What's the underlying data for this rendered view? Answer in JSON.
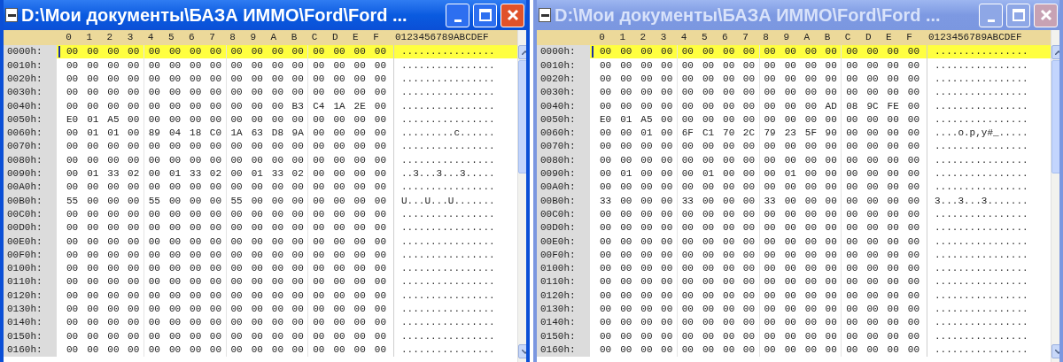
{
  "windows": [
    {
      "title": "D:\\Мои документы\\БАЗА ИММО\\Ford\\Ford ...",
      "active": true,
      "header": {
        "columns": [
          "0",
          "1",
          "2",
          "3",
          "4",
          "5",
          "6",
          "7",
          "8",
          "9",
          "A",
          "B",
          "C",
          "D",
          "E",
          "F"
        ],
        "ascii": "0123456789ABCDEF"
      },
      "rows": [
        {
          "offset": "0000h:",
          "bytes": [
            "00",
            "00",
            "00",
            "00",
            "00",
            "00",
            "00",
            "00",
            "00",
            "00",
            "00",
            "00",
            "00",
            "00",
            "00",
            "00"
          ],
          "ascii": "................",
          "selected": true
        },
        {
          "offset": "0010h:",
          "bytes": [
            "00",
            "00",
            "00",
            "00",
            "00",
            "00",
            "00",
            "00",
            "00",
            "00",
            "00",
            "00",
            "00",
            "00",
            "00",
            "00"
          ],
          "ascii": "................",
          "selected": false
        },
        {
          "offset": "0020h:",
          "bytes": [
            "00",
            "00",
            "00",
            "00",
            "00",
            "00",
            "00",
            "00",
            "00",
            "00",
            "00",
            "00",
            "00",
            "00",
            "00",
            "00"
          ],
          "ascii": "................",
          "selected": false
        },
        {
          "offset": "0030h:",
          "bytes": [
            "00",
            "00",
            "00",
            "00",
            "00",
            "00",
            "00",
            "00",
            "00",
            "00",
            "00",
            "00",
            "00",
            "00",
            "00",
            "00"
          ],
          "ascii": "................",
          "selected": false
        },
        {
          "offset": "0040h:",
          "bytes": [
            "00",
            "00",
            "00",
            "00",
            "00",
            "00",
            "00",
            "00",
            "00",
            "00",
            "00",
            "B3",
            "C4",
            "1A",
            "2E",
            "00"
          ],
          "ascii": "................",
          "selected": false
        },
        {
          "offset": "0050h:",
          "bytes": [
            "E0",
            "01",
            "A5",
            "00",
            "00",
            "00",
            "00",
            "00",
            "00",
            "00",
            "00",
            "00",
            "00",
            "00",
            "00",
            "00"
          ],
          "ascii": "................",
          "selected": false
        },
        {
          "offset": "0060h:",
          "bytes": [
            "00",
            "01",
            "01",
            "00",
            "89",
            "04",
            "18",
            "C0",
            "1A",
            "63",
            "D8",
            "9A",
            "00",
            "00",
            "00",
            "00"
          ],
          "ascii": ".........c......",
          "selected": false
        },
        {
          "offset": "0070h:",
          "bytes": [
            "00",
            "00",
            "00",
            "00",
            "00",
            "00",
            "00",
            "00",
            "00",
            "00",
            "00",
            "00",
            "00",
            "00",
            "00",
            "00"
          ],
          "ascii": "................",
          "selected": false
        },
        {
          "offset": "0080h:",
          "bytes": [
            "00",
            "00",
            "00",
            "00",
            "00",
            "00",
            "00",
            "00",
            "00",
            "00",
            "00",
            "00",
            "00",
            "00",
            "00",
            "00"
          ],
          "ascii": "................",
          "selected": false
        },
        {
          "offset": "0090h:",
          "bytes": [
            "00",
            "01",
            "33",
            "02",
            "00",
            "01",
            "33",
            "02",
            "00",
            "01",
            "33",
            "02",
            "00",
            "00",
            "00",
            "00"
          ],
          "ascii": "..3...3...3.....",
          "selected": false
        },
        {
          "offset": "00A0h:",
          "bytes": [
            "00",
            "00",
            "00",
            "00",
            "00",
            "00",
            "00",
            "00",
            "00",
            "00",
            "00",
            "00",
            "00",
            "00",
            "00",
            "00"
          ],
          "ascii": "................",
          "selected": false
        },
        {
          "offset": "00B0h:",
          "bytes": [
            "55",
            "00",
            "00",
            "00",
            "55",
            "00",
            "00",
            "00",
            "55",
            "00",
            "00",
            "00",
            "00",
            "00",
            "00",
            "00"
          ],
          "ascii": "U...U...U.......",
          "selected": false
        },
        {
          "offset": "00C0h:",
          "bytes": [
            "00",
            "00",
            "00",
            "00",
            "00",
            "00",
            "00",
            "00",
            "00",
            "00",
            "00",
            "00",
            "00",
            "00",
            "00",
            "00"
          ],
          "ascii": "................",
          "selected": false
        },
        {
          "offset": "00D0h:",
          "bytes": [
            "00",
            "00",
            "00",
            "00",
            "00",
            "00",
            "00",
            "00",
            "00",
            "00",
            "00",
            "00",
            "00",
            "00",
            "00",
            "00"
          ],
          "ascii": "................",
          "selected": false
        },
        {
          "offset": "00E0h:",
          "bytes": [
            "00",
            "00",
            "00",
            "00",
            "00",
            "00",
            "00",
            "00",
            "00",
            "00",
            "00",
            "00",
            "00",
            "00",
            "00",
            "00"
          ],
          "ascii": "................",
          "selected": false
        },
        {
          "offset": "00F0h:",
          "bytes": [
            "00",
            "00",
            "00",
            "00",
            "00",
            "00",
            "00",
            "00",
            "00",
            "00",
            "00",
            "00",
            "00",
            "00",
            "00",
            "00"
          ],
          "ascii": "................",
          "selected": false
        },
        {
          "offset": "0100h:",
          "bytes": [
            "00",
            "00",
            "00",
            "00",
            "00",
            "00",
            "00",
            "00",
            "00",
            "00",
            "00",
            "00",
            "00",
            "00",
            "00",
            "00"
          ],
          "ascii": "................",
          "selected": false
        },
        {
          "offset": "0110h:",
          "bytes": [
            "00",
            "00",
            "00",
            "00",
            "00",
            "00",
            "00",
            "00",
            "00",
            "00",
            "00",
            "00",
            "00",
            "00",
            "00",
            "00"
          ],
          "ascii": "................",
          "selected": false
        },
        {
          "offset": "0120h:",
          "bytes": [
            "00",
            "00",
            "00",
            "00",
            "00",
            "00",
            "00",
            "00",
            "00",
            "00",
            "00",
            "00",
            "00",
            "00",
            "00",
            "00"
          ],
          "ascii": "................",
          "selected": false
        },
        {
          "offset": "0130h:",
          "bytes": [
            "00",
            "00",
            "00",
            "00",
            "00",
            "00",
            "00",
            "00",
            "00",
            "00",
            "00",
            "00",
            "00",
            "00",
            "00",
            "00"
          ],
          "ascii": "................",
          "selected": false
        },
        {
          "offset": "0140h:",
          "bytes": [
            "00",
            "00",
            "00",
            "00",
            "00",
            "00",
            "00",
            "00",
            "00",
            "00",
            "00",
            "00",
            "00",
            "00",
            "00",
            "00"
          ],
          "ascii": "................",
          "selected": false
        },
        {
          "offset": "0150h:",
          "bytes": [
            "00",
            "00",
            "00",
            "00",
            "00",
            "00",
            "00",
            "00",
            "00",
            "00",
            "00",
            "00",
            "00",
            "00",
            "00",
            "00"
          ],
          "ascii": "................",
          "selected": false
        },
        {
          "offset": "0160h:",
          "bytes": [
            "00",
            "00",
            "00",
            "00",
            "00",
            "00",
            "00",
            "00",
            "00",
            "00",
            "00",
            "00",
            "00",
            "00",
            "00",
            "00"
          ],
          "ascii": "................",
          "selected": false
        }
      ]
    },
    {
      "title": "D:\\Мои документы\\БАЗА ИММО\\Ford\\Ford ...",
      "active": false,
      "header": {
        "columns": [
          "0",
          "1",
          "2",
          "3",
          "4",
          "5",
          "6",
          "7",
          "8",
          "9",
          "A",
          "B",
          "C",
          "D",
          "E",
          "F"
        ],
        "ascii": "0123456789ABCDEF"
      },
      "rows": [
        {
          "offset": "0000h:",
          "bytes": [
            "00",
            "00",
            "00",
            "00",
            "00",
            "00",
            "00",
            "00",
            "00",
            "00",
            "00",
            "00",
            "00",
            "00",
            "00",
            "00"
          ],
          "ascii": "................",
          "selected": true
        },
        {
          "offset": "0010h:",
          "bytes": [
            "00",
            "00",
            "00",
            "00",
            "00",
            "00",
            "00",
            "00",
            "00",
            "00",
            "00",
            "00",
            "00",
            "00",
            "00",
            "00"
          ],
          "ascii": "................",
          "selected": false
        },
        {
          "offset": "0020h:",
          "bytes": [
            "00",
            "00",
            "00",
            "00",
            "00",
            "00",
            "00",
            "00",
            "00",
            "00",
            "00",
            "00",
            "00",
            "00",
            "00",
            "00"
          ],
          "ascii": "................",
          "selected": false
        },
        {
          "offset": "0030h:",
          "bytes": [
            "00",
            "00",
            "00",
            "00",
            "00",
            "00",
            "00",
            "00",
            "00",
            "00",
            "00",
            "00",
            "00",
            "00",
            "00",
            "00"
          ],
          "ascii": "................",
          "selected": false
        },
        {
          "offset": "0040h:",
          "bytes": [
            "00",
            "00",
            "00",
            "00",
            "00",
            "00",
            "00",
            "00",
            "00",
            "00",
            "00",
            "AD",
            "08",
            "9C",
            "FE",
            "00"
          ],
          "ascii": "................",
          "selected": false
        },
        {
          "offset": "0050h:",
          "bytes": [
            "E0",
            "01",
            "A5",
            "00",
            "00",
            "00",
            "00",
            "00",
            "00",
            "00",
            "00",
            "00",
            "00",
            "00",
            "00",
            "00"
          ],
          "ascii": "................",
          "selected": false
        },
        {
          "offset": "0060h:",
          "bytes": [
            "00",
            "00",
            "01",
            "00",
            "6F",
            "C1",
            "70",
            "2C",
            "79",
            "23",
            "5F",
            "90",
            "00",
            "00",
            "00",
            "00"
          ],
          "ascii": "....o.p,y#_.....",
          "selected": false
        },
        {
          "offset": "0070h:",
          "bytes": [
            "00",
            "00",
            "00",
            "00",
            "00",
            "00",
            "00",
            "00",
            "00",
            "00",
            "00",
            "00",
            "00",
            "00",
            "00",
            "00"
          ],
          "ascii": "................",
          "selected": false
        },
        {
          "offset": "0080h:",
          "bytes": [
            "00",
            "00",
            "00",
            "00",
            "00",
            "00",
            "00",
            "00",
            "00",
            "00",
            "00",
            "00",
            "00",
            "00",
            "00",
            "00"
          ],
          "ascii": "................",
          "selected": false
        },
        {
          "offset": "0090h:",
          "bytes": [
            "00",
            "01",
            "00",
            "00",
            "00",
            "01",
            "00",
            "00",
            "00",
            "01",
            "00",
            "00",
            "00",
            "00",
            "00",
            "00"
          ],
          "ascii": "................",
          "selected": false
        },
        {
          "offset": "00A0h:",
          "bytes": [
            "00",
            "00",
            "00",
            "00",
            "00",
            "00",
            "00",
            "00",
            "00",
            "00",
            "00",
            "00",
            "00",
            "00",
            "00",
            "00"
          ],
          "ascii": "................",
          "selected": false
        },
        {
          "offset": "00B0h:",
          "bytes": [
            "33",
            "00",
            "00",
            "00",
            "33",
            "00",
            "00",
            "00",
            "33",
            "00",
            "00",
            "00",
            "00",
            "00",
            "00",
            "00"
          ],
          "ascii": "3...3...3.......",
          "selected": false
        },
        {
          "offset": "00C0h:",
          "bytes": [
            "00",
            "00",
            "00",
            "00",
            "00",
            "00",
            "00",
            "00",
            "00",
            "00",
            "00",
            "00",
            "00",
            "00",
            "00",
            "00"
          ],
          "ascii": "................",
          "selected": false
        },
        {
          "offset": "00D0h:",
          "bytes": [
            "00",
            "00",
            "00",
            "00",
            "00",
            "00",
            "00",
            "00",
            "00",
            "00",
            "00",
            "00",
            "00",
            "00",
            "00",
            "00"
          ],
          "ascii": "................",
          "selected": false
        },
        {
          "offset": "00E0h:",
          "bytes": [
            "00",
            "00",
            "00",
            "00",
            "00",
            "00",
            "00",
            "00",
            "00",
            "00",
            "00",
            "00",
            "00",
            "00",
            "00",
            "00"
          ],
          "ascii": "................",
          "selected": false
        },
        {
          "offset": "00F0h:",
          "bytes": [
            "00",
            "00",
            "00",
            "00",
            "00",
            "00",
            "00",
            "00",
            "00",
            "00",
            "00",
            "00",
            "00",
            "00",
            "00",
            "00"
          ],
          "ascii": "................",
          "selected": false
        },
        {
          "offset": "0100h:",
          "bytes": [
            "00",
            "00",
            "00",
            "00",
            "00",
            "00",
            "00",
            "00",
            "00",
            "00",
            "00",
            "00",
            "00",
            "00",
            "00",
            "00"
          ],
          "ascii": "................",
          "selected": false
        },
        {
          "offset": "0110h:",
          "bytes": [
            "00",
            "00",
            "00",
            "00",
            "00",
            "00",
            "00",
            "00",
            "00",
            "00",
            "00",
            "00",
            "00",
            "00",
            "00",
            "00"
          ],
          "ascii": "................",
          "selected": false
        },
        {
          "offset": "0120h:",
          "bytes": [
            "00",
            "00",
            "00",
            "00",
            "00",
            "00",
            "00",
            "00",
            "00",
            "00",
            "00",
            "00",
            "00",
            "00",
            "00",
            "00"
          ],
          "ascii": "................",
          "selected": false
        },
        {
          "offset": "0130h:",
          "bytes": [
            "00",
            "00",
            "00",
            "00",
            "00",
            "00",
            "00",
            "00",
            "00",
            "00",
            "00",
            "00",
            "00",
            "00",
            "00",
            "00"
          ],
          "ascii": "................",
          "selected": false
        },
        {
          "offset": "0140h:",
          "bytes": [
            "00",
            "00",
            "00",
            "00",
            "00",
            "00",
            "00",
            "00",
            "00",
            "00",
            "00",
            "00",
            "00",
            "00",
            "00",
            "00"
          ],
          "ascii": "................",
          "selected": false
        },
        {
          "offset": "0150h:",
          "bytes": [
            "00",
            "00",
            "00",
            "00",
            "00",
            "00",
            "00",
            "00",
            "00",
            "00",
            "00",
            "00",
            "00",
            "00",
            "00",
            "00"
          ],
          "ascii": "................",
          "selected": false
        },
        {
          "offset": "0160h:",
          "bytes": [
            "00",
            "00",
            "00",
            "00",
            "00",
            "00",
            "00",
            "00",
            "00",
            "00",
            "00",
            "00",
            "00",
            "00",
            "00",
            "00"
          ],
          "ascii": "................",
          "selected": false
        }
      ]
    }
  ]
}
